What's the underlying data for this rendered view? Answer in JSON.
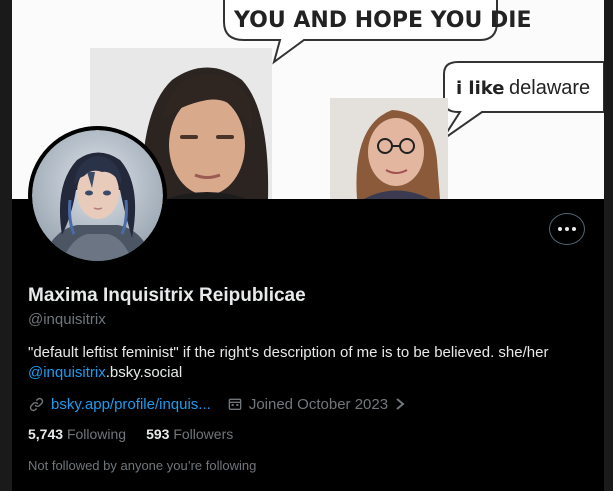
{
  "banner": {
    "bubble_top_text": "YOU AND HOPE YOU DIE",
    "bubble_right_prefix": "i like",
    "bubble_right_word": "delaware"
  },
  "profile": {
    "display_name": "Maxima Inquisitrix Reipublicae",
    "handle": "@inquisitrix",
    "bio_line1": "\"default leftist feminist\" if the right's description of me is to be believed. she/her",
    "bio_link": "@inquisitrix",
    "bio_suffix": ".bsky.social",
    "website": "bsky.app/profile/inquis...",
    "joined": "Joined October 2023",
    "following_count": "5,743",
    "following_label": "Following",
    "followers_count": "593",
    "followers_label": "Followers",
    "followed_by_note": "Not followed by anyone you’re following"
  },
  "icons": {
    "more": "more-horizontal-icon",
    "link": "link-icon",
    "calendar": "calendar-icon",
    "chevron": "chevron-right-icon"
  },
  "colors": {
    "accent": "#1d9bf0",
    "secondary_text": "#71767b",
    "primary_text": "#e7e9ea",
    "background": "#000000"
  }
}
